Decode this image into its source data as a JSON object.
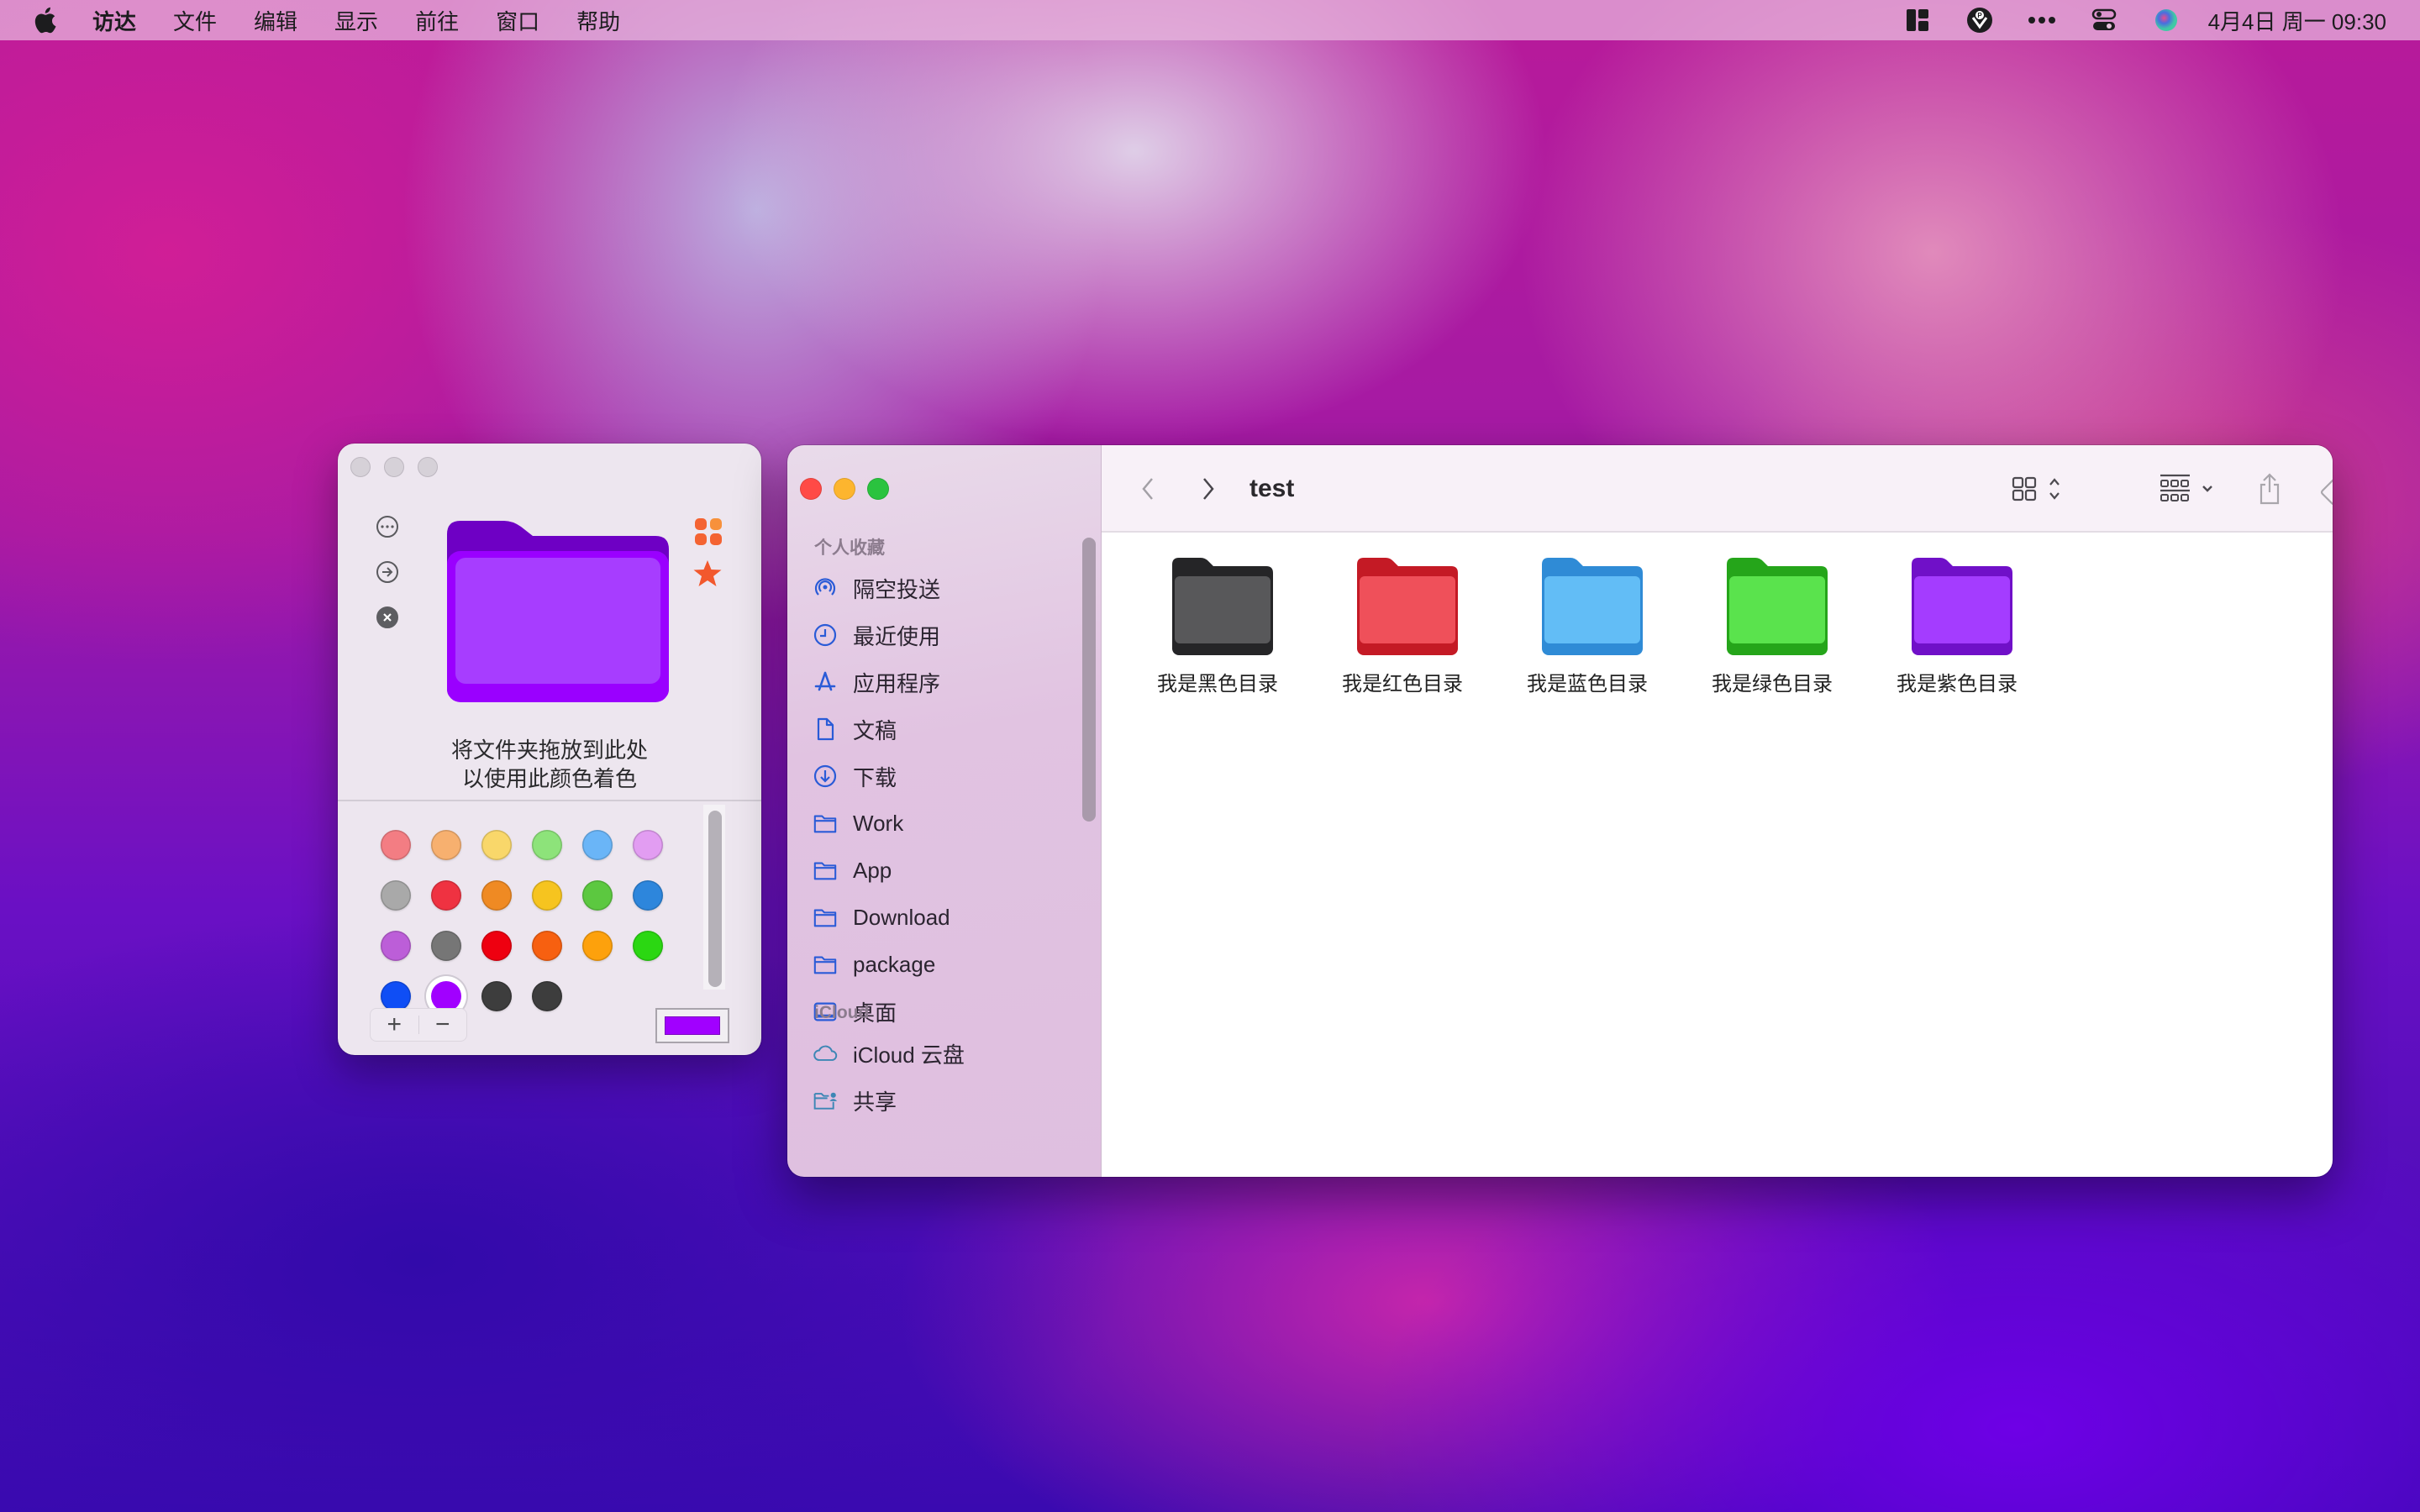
{
  "menubar": {
    "app_name": "访达",
    "menus": [
      "文件",
      "编辑",
      "显示",
      "前往",
      "窗口",
      "帮助"
    ],
    "status_icons": [
      "window-layout-icon",
      "producthunt-icon",
      "more-icon",
      "control-center-icon",
      "siri-icon"
    ],
    "clock": "4月4日 周一  09:30"
  },
  "colorizer": {
    "drop_line1": "将文件夹拖放到此处",
    "drop_line2": "以使用此颜色着色",
    "side_buttons": [
      "more-icon",
      "arrow-right-icon",
      "close-icon"
    ],
    "preview_color": "#a13bff",
    "swatches": [
      [
        "#f37d83",
        "#f7b06f",
        "#f9d76a",
        "#8de37a",
        "#6ab5f7",
        "#e29df2"
      ],
      [
        "#a9a9a9",
        "#ef3241",
        "#ef8a23",
        "#f6c41f",
        "#5cc840",
        "#2d86dc"
      ],
      [
        "#bc5ed8",
        "#767676",
        "#ee0010",
        "#f76010",
        "#fda10c",
        "#2bd712"
      ],
      [
        "#0f4ef5",
        "#a100ff",
        "#3d3d3d",
        "#3d3d3d"
      ]
    ],
    "selected_swatch": "#a100ff",
    "add_label": "+",
    "remove_label": "−",
    "current_color": "#a100ff"
  },
  "finder": {
    "title": "test",
    "sidebar": {
      "favorites_title": "个人收藏",
      "favorites": [
        {
          "label": "隔空投送",
          "icon": "airdrop-icon"
        },
        {
          "label": "最近使用",
          "icon": "clock-icon"
        },
        {
          "label": "应用程序",
          "icon": "applications-icon"
        },
        {
          "label": "文稿",
          "icon": "document-icon"
        },
        {
          "label": "下载",
          "icon": "download-icon"
        },
        {
          "label": "Work",
          "icon": "folder-icon"
        },
        {
          "label": "App",
          "icon": "folder-icon"
        },
        {
          "label": "Download",
          "icon": "folder-icon"
        },
        {
          "label": "package",
          "icon": "folder-icon"
        },
        {
          "label": "桌面",
          "icon": "desktop-icon"
        }
      ],
      "icloud_title": "iCloud",
      "icloud": [
        {
          "label": "iCloud 云盘",
          "icon": "cloud-icon"
        },
        {
          "label": "共享",
          "icon": "shared-folder-icon"
        }
      ]
    },
    "toolbar": [
      "back-icon",
      "forward-icon",
      "icon-view-icon",
      "group-icon",
      "share-icon",
      "tag-icon",
      "action-icon",
      "search-icon"
    ],
    "items": [
      {
        "name": "我是黑色目录",
        "back": "#252527",
        "front": "#58585a"
      },
      {
        "name": "我是红色目录",
        "back": "#c41a25",
        "front": "#ef505a"
      },
      {
        "name": "我是蓝色目录",
        "back": "#2f8bd6",
        "front": "#62bdf6"
      },
      {
        "name": "我是绿色目录",
        "back": "#25a51a",
        "front": "#5ae34d"
      },
      {
        "name": "我是紫色目录",
        "back": "#7010c8",
        "front": "#a43cff"
      }
    ]
  }
}
